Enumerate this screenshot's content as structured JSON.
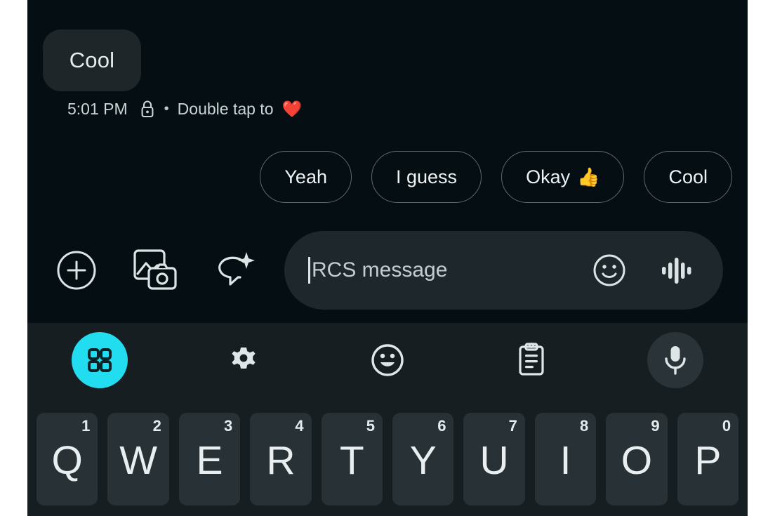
{
  "app": {
    "name": "google-messages-rcs-chat",
    "colors": {
      "page_background": "#ffffff",
      "chat_background": "#050e12",
      "bubble_background": "#1e262a",
      "keyboard_background": "#161e22",
      "key_background": "#283135",
      "accent_cyan": "#22dcf0",
      "text_primary": "#e9eef0",
      "text_secondary": "#c8d0d2",
      "chip_border": "#5d6a6e",
      "input_background": "#1e272b"
    }
  },
  "conversation": {
    "message": {
      "text": "Cool",
      "align": "left"
    },
    "meta": {
      "time": "5:01 PM",
      "lock_icon": "lock-icon",
      "separator": "•",
      "label": "Double tap to",
      "reaction_emoji": "❤️"
    }
  },
  "suggestions": {
    "chips": [
      {
        "label": "Yeah",
        "emoji": ""
      },
      {
        "label": "I guess",
        "emoji": ""
      },
      {
        "label": "Okay",
        "emoji": "👍"
      },
      {
        "label": "Cool",
        "emoji": ""
      }
    ]
  },
  "compose": {
    "left_icons": [
      {
        "name": "plus-circle-icon",
        "label": "Add attachment"
      },
      {
        "name": "gallery-camera-icon",
        "label": "Gallery and camera"
      },
      {
        "name": "magic-compose-icon",
        "label": "Magic Compose"
      }
    ],
    "input": {
      "placeholder": "RCS message",
      "value": "",
      "caret_visible": true
    },
    "inline_icons": [
      {
        "name": "emoji-smiley-icon",
        "label": "Emoji"
      },
      {
        "name": "audio-waveform-icon",
        "label": "Voice message"
      }
    ]
  },
  "keyboard": {
    "toolbar": [
      {
        "name": "grid-apps-icon",
        "label": "Toolbar menu",
        "state": "active"
      },
      {
        "name": "gear-icon",
        "label": "Settings",
        "state": "default"
      },
      {
        "name": "emoji-smiley-icon",
        "label": "Emoji",
        "state": "default"
      },
      {
        "name": "clipboard-icon",
        "label": "Clipboard",
        "state": "default"
      },
      {
        "name": "microphone-icon",
        "label": "Voice input",
        "state": "default"
      }
    ],
    "rows": [
      {
        "name": "top-row",
        "keys": [
          {
            "letter": "Q",
            "number": "1"
          },
          {
            "letter": "W",
            "number": "2"
          },
          {
            "letter": "E",
            "number": "3"
          },
          {
            "letter": "R",
            "number": "4"
          },
          {
            "letter": "T",
            "number": "5"
          },
          {
            "letter": "Y",
            "number": "6"
          },
          {
            "letter": "U",
            "number": "7"
          },
          {
            "letter": "I",
            "number": "8"
          },
          {
            "letter": "O",
            "number": "9"
          },
          {
            "letter": "P",
            "number": "0"
          }
        ]
      }
    ]
  }
}
